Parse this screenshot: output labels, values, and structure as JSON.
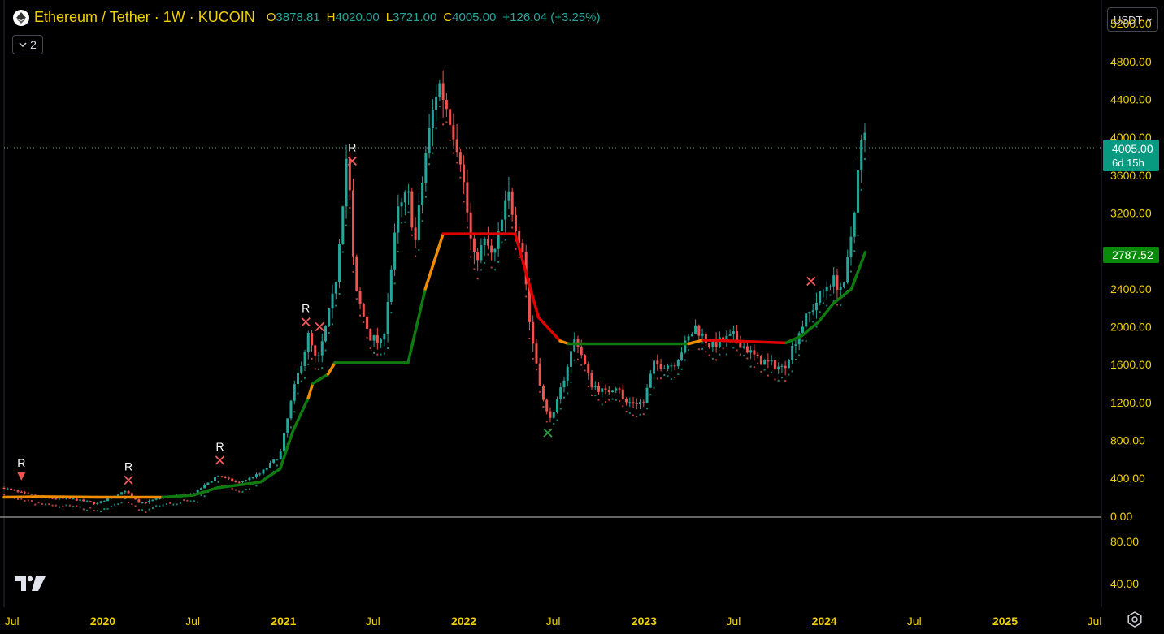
{
  "legend": {
    "symbol": "Ethereum / Tether · 1W · KUCOIN",
    "open_label": "O",
    "open": "3878.81",
    "high_label": "H",
    "high": "4020.00",
    "low_label": "L",
    "low": "3721.00",
    "close_label": "C",
    "close": "4005.00",
    "change": "+126.04 (+3.25%)",
    "indicator_count": "2"
  },
  "currency": "USDT",
  "price_tag": {
    "value": "4005.00",
    "countdown": "6d 15h"
  },
  "indicator_tag": "2787.52",
  "colors": {
    "background": "#000000",
    "up": "#26a69a",
    "down": "#ef5350",
    "trend_up": "#0f7a0f",
    "trend_down": "#e00000",
    "trend_flat": "#f08c00",
    "axis_text": "#f0d000",
    "tag_bg": "#089981",
    "indicator_tag_bg": "#0a8a0a"
  },
  "icons": {
    "logo": "ethereum-logo-icon",
    "chevron": "chevron-down-icon",
    "settings": "gear-icon",
    "brand": "tradingview-logo-icon"
  },
  "chart_data": {
    "type": "candlestick",
    "interval": "1W",
    "y_axis": {
      "ticks": [
        "5200.00",
        "4800.00",
        "4400.00",
        "4000.00",
        "3600.00",
        "3200.00",
        "2800.00",
        "2400.00",
        "2000.00",
        "1600.00",
        "1200.00",
        "800.00",
        "400.00",
        "0.00"
      ],
      "range": [
        -10,
        5450
      ]
    },
    "x_axis": {
      "ticks": [
        "Jul",
        "2020",
        "Jul",
        "2021",
        "Jul",
        "2022",
        "Jul",
        "2023",
        "Jul",
        "2024",
        "Jul",
        "2025",
        "Jul"
      ],
      "range": [
        "2019-06-15",
        "2025-07-15"
      ]
    },
    "sub_pane": {
      "ticks": [
        "80.00",
        "40.00"
      ]
    },
    "price_anchors": [
      [
        "2019-06-15",
        300
      ],
      [
        "2019-07-15",
        250
      ],
      [
        "2019-09-01",
        190
      ],
      [
        "2019-11-01",
        180
      ],
      [
        "2019-12-20",
        130
      ],
      [
        "2020-02-15",
        270
      ],
      [
        "2020-03-15",
        130
      ],
      [
        "2020-05-01",
        200
      ],
      [
        "2020-07-01",
        230
      ],
      [
        "2020-08-20",
        430
      ],
      [
        "2020-10-01",
        350
      ],
      [
        "2020-11-15",
        450
      ],
      [
        "2020-12-25",
        650
      ],
      [
        "2021-01-20",
        1300
      ],
      [
        "2021-02-20",
        1900
      ],
      [
        "2021-03-10",
        1600
      ],
      [
        "2021-04-15",
        2400
      ],
      [
        "2021-05-10",
        3900
      ],
      [
        "2021-05-25",
        2400
      ],
      [
        "2021-06-25",
        1900
      ],
      [
        "2021-07-20",
        1800
      ],
      [
        "2021-08-20",
        3200
      ],
      [
        "2021-09-10",
        3400
      ],
      [
        "2021-09-25",
        2900
      ],
      [
        "2021-10-15",
        3800
      ],
      [
        "2021-11-10",
        4600
      ],
      [
        "2021-12-05",
        4200
      ],
      [
        "2021-12-25",
        3800
      ],
      [
        "2022-01-20",
        2700
      ],
      [
        "2022-02-15",
        2900
      ],
      [
        "2022-03-01",
        2700
      ],
      [
        "2022-04-01",
        3400
      ],
      [
        "2022-05-01",
        2800
      ],
      [
        "2022-05-15",
        2000
      ],
      [
        "2022-06-15",
        1100
      ],
      [
        "2022-07-01",
        1050
      ],
      [
        "2022-08-15",
        1900
      ],
      [
        "2022-09-15",
        1400
      ],
      [
        "2022-10-15",
        1300
      ],
      [
        "2022-11-10",
        1400
      ],
      [
        "2022-11-20",
        1200
      ],
      [
        "2022-12-31",
        1200
      ],
      [
        "2023-01-20",
        1600
      ],
      [
        "2023-03-01",
        1600
      ],
      [
        "2023-04-15",
        2000
      ],
      [
        "2023-05-15",
        1800
      ],
      [
        "2023-07-01",
        1900
      ],
      [
        "2023-08-20",
        1650
      ],
      [
        "2023-10-10",
        1560
      ],
      [
        "2023-11-15",
        2000
      ],
      [
        "2023-12-20",
        2300
      ],
      [
        "2024-01-15",
        2500
      ],
      [
        "2024-02-10",
        2400
      ],
      [
        "2024-02-25",
        3000
      ],
      [
        "2024-03-15",
        3900
      ],
      [
        "2024-03-24",
        4005
      ]
    ],
    "trend_line": [
      [
        "2019-06-15",
        200,
        "flat"
      ],
      [
        "2019-09-01",
        205,
        "flat"
      ],
      [
        "2019-12-20",
        200,
        "flat"
      ],
      [
        "2020-02-15",
        200,
        "flat"
      ],
      [
        "2020-05-01",
        200,
        "flat"
      ],
      [
        "2020-07-01",
        220,
        "up"
      ],
      [
        "2020-08-20",
        300,
        "up"
      ],
      [
        "2020-11-15",
        360,
        "up"
      ],
      [
        "2020-12-25",
        500,
        "up"
      ],
      [
        "2021-01-20",
        900,
        "up"
      ],
      [
        "2021-02-20",
        1250,
        "up"
      ],
      [
        "2021-03-01",
        1400,
        "flat"
      ],
      [
        "2021-04-01",
        1500,
        "up"
      ],
      [
        "2021-04-15",
        1620,
        "flat"
      ],
      [
        "2021-09-10",
        1620,
        "up"
      ],
      [
        "2021-10-15",
        2400,
        "up"
      ],
      [
        "2021-11-20",
        2980,
        "flat"
      ],
      [
        "2022-04-15",
        2980,
        "down"
      ],
      [
        "2022-06-01",
        2100,
        "down"
      ],
      [
        "2022-07-15",
        1850,
        "down"
      ],
      [
        "2022-08-01",
        1820,
        "flat"
      ],
      [
        "2023-04-01",
        1820,
        "up"
      ],
      [
        "2023-05-01",
        1860,
        "flat"
      ],
      [
        "2023-10-15",
        1830,
        "down"
      ],
      [
        "2023-11-15",
        1900,
        "up"
      ],
      [
        "2023-12-20",
        2050,
        "up"
      ],
      [
        "2024-01-20",
        2250,
        "up"
      ],
      [
        "2024-02-25",
        2400,
        "up"
      ],
      [
        "2024-03-24",
        2788,
        "up"
      ]
    ],
    "signals": [
      {
        "date": "2019-07-20",
        "price": 420,
        "shape": "triangle",
        "label": "R"
      },
      {
        "date": "2020-02-22",
        "price": 380,
        "shape": "cross",
        "label": "R"
      },
      {
        "date": "2020-08-25",
        "price": 590,
        "shape": "cross",
        "label": "R"
      },
      {
        "date": "2021-02-15",
        "price": 2050,
        "shape": "cross",
        "label": "R"
      },
      {
        "date": "2021-03-15",
        "price": 2000,
        "shape": "cross",
        "label": ""
      },
      {
        "date": "2021-05-20",
        "price": 3750,
        "shape": "cross",
        "label": "R"
      },
      {
        "date": "2022-06-20",
        "price": 880,
        "shape": "cross-green",
        "label": ""
      },
      {
        "date": "2023-12-05",
        "price": 2480,
        "shape": "cross",
        "label": ""
      }
    ]
  }
}
